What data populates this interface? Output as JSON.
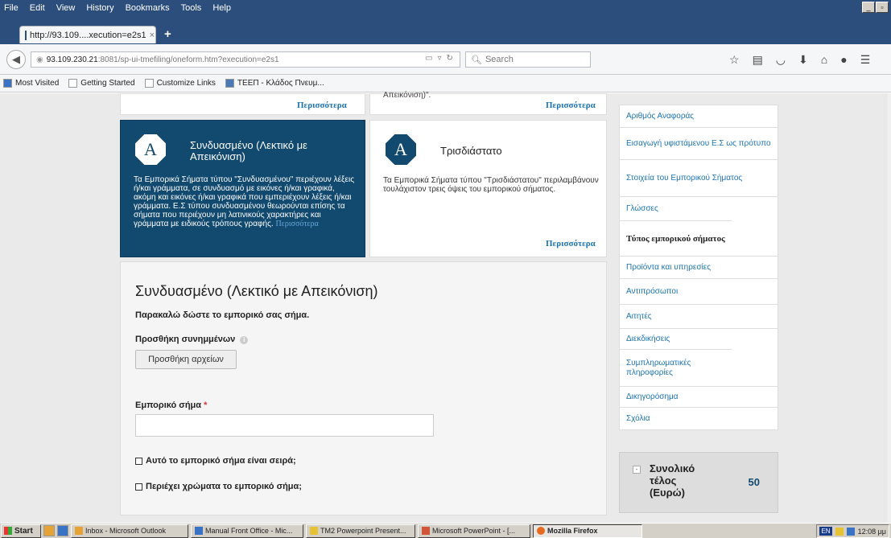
{
  "browser": {
    "menu": [
      "File",
      "Edit",
      "View",
      "History",
      "Bookmarks",
      "Tools",
      "Help"
    ],
    "tab_title": "http://93.109....xecution=e2s1",
    "tab_close": "×",
    "new_tab": "+",
    "url_host": "93.109.230.21",
    "url_rest": ":8081/sp-ui-tmefiling/oneform.htm?execution=e2s1",
    "search_placeholder": "Search",
    "bookmarks": [
      "Most Visited",
      "Getting Started",
      "Customize Links",
      "ΤΕΕΠ - Κλάδος Πνευμ..."
    ]
  },
  "cards": {
    "top_left_more": "Περισσότερα",
    "top_right_snippet": "Απεικόνιση)\".",
    "top_right_more": "Περισσότερα",
    "combined": {
      "icon_letter": "A",
      "title": "Συνδυασμένο (Λεκτικό με Απεικόνιση)",
      "desc": "Τα Εμπορικά Σήματα τύπου \"Συνδυασμένου\" περιέχουν λέξεις ή/και γράμματα, σε συνδυασμό με εικόνες ή/και γραφικά, ακόμη και εικόνες ή/και γραφικά που εμπεριέχουν λέξεις ή/και γράμματα. Ε.Σ τύπου συνδυασμένου θεωρούνται επίσης τα σήματα που περιέχουν μη λατινικούς χαρακτήρες και γράμματα με ειδικούς τρόπους γραφής.",
      "more": "Περισσότερα"
    },
    "threed": {
      "icon_letter": "A",
      "title": "Τρισδιάστατο",
      "desc": "Τα Εμπορικά Σήματα τύπου \"Τρισδιάστατου\" περιλαμβάνουν τουλάχιστον τρεις όψεις του εμπορικού σήματος.",
      "more": "Περισσότερα"
    }
  },
  "form": {
    "title": "Συνδυασμένο (Λεκτικό με Απεικόνιση)",
    "prompt": "Παρακαλώ δώστε το εμπορικό σας σήμα.",
    "attachments_label": "Προσθήκη συνημμένων",
    "info_icon": "i",
    "add_files_button": "Προσθήκη αρχείων",
    "trademark_label": "Εμπορικό σήμα",
    "required_mark": "*",
    "trademark_value": "",
    "series_checkbox": "Αυτό το εμπορικό σήμα είναι σειρά;",
    "colors_checkbox": "Περιέχει χρώματα το εμπορικό σήμα;"
  },
  "sidebar": {
    "items": [
      {
        "label": "Αριθμός Αναφοράς"
      },
      {
        "label": "Εισαγωγή υφιστάμενου Ε.Σ ως πρότυπο"
      },
      {
        "label": "Στοιχεία του Εμπορικού Σήματος"
      },
      {
        "label": "Γλώσσες"
      },
      {
        "label": "Τύπος εμπορικού σήματος"
      },
      {
        "label": "Προϊόντα και υπηρεσίες"
      },
      {
        "label": "Αντιπρόσωποι"
      },
      {
        "label": "Αιτητές"
      },
      {
        "label": "Διεκδικήσεις"
      },
      {
        "label": "Συμπληρωματικές πληροφορίες"
      },
      {
        "label": "Δικηγορόσημα"
      },
      {
        "label": "Σχόλια"
      }
    ],
    "active_index": 4
  },
  "fee": {
    "label": "Συνολικό τέλος (Ευρώ)",
    "value": "50",
    "toggle": "-"
  },
  "taskbar": {
    "start": "Start",
    "tasks": [
      "Inbox - Microsoft Outlook",
      "Manual Front Office - Mic...",
      "TM2 Powerpoint Present...",
      "Microsoft PowerPoint - [...",
      "Mozilla Firefox"
    ],
    "lang": "EN",
    "time": "12:08 μμ"
  }
}
